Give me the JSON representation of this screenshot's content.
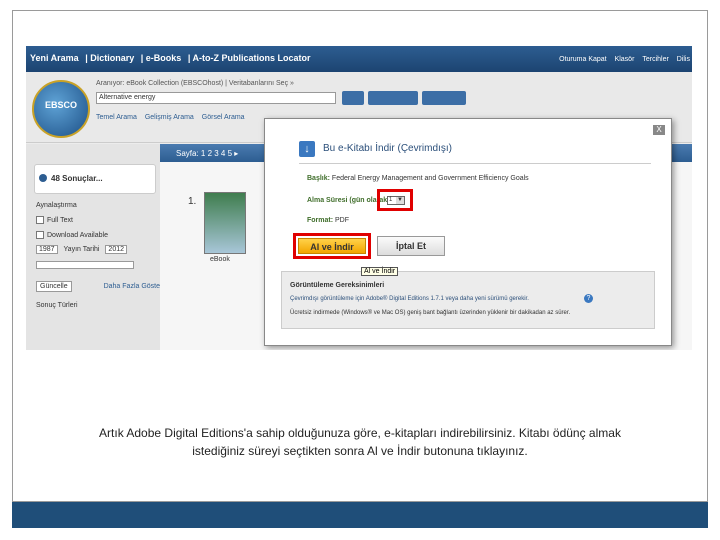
{
  "top_nav": {
    "links": [
      "Yeni Arama",
      "| Dictionary",
      "| e-Books",
      "| A-to-Z Publications Locator"
    ],
    "right": [
      "Oturuma Kapat",
      "Klasör",
      "Tercihler",
      "Dilis"
    ]
  },
  "header": {
    "logo_text": "EBSCO",
    "search_label": "Aranıyor: eBook Collection (EBSCOhost)  |  Veritabanlarını Seç »",
    "search_value": "Alternative energy",
    "search_links": [
      "Temel Arama",
      "Gelişmiş Arama",
      "Görsel Arama"
    ]
  },
  "left_panel": {
    "results_label": "48 Sonuçlar...",
    "refine_label": "Aynalaştırma",
    "filters": [
      "Full Text",
      "Download Available"
    ],
    "year_from": "1987",
    "year_label": "Yayın Tarihi",
    "year_to": "2012",
    "update_button": "Güncelle",
    "more_link": "Daha Fazla Göster »",
    "subject_label": "Sonuç Türleri"
  },
  "pager": {
    "text": "Sayfa: 1 2 3 4 5 ▸"
  },
  "result": {
    "number": "1.",
    "format": "eBook"
  },
  "dialog": {
    "title": "Bu e-Kitabı İndir (Çevrimdışı)",
    "title_label": "Başlık:",
    "title_value": "Federal Energy Management and Government Efficiency Goals",
    "loan_label": "Alma Süresi (gün olarak):",
    "loan_value": "1",
    "format_label": "Format:",
    "format_value": "PDF",
    "get_button": "Al ve İndir",
    "cancel_button": "İptal Et",
    "tooltip": "Al ve İndir",
    "close_label": "X",
    "requirements": {
      "heading": "Görüntüleme Gereksinimleri",
      "line1": "Çevrimdışı görüntüleme için Adobe® Digital Editions 1.7.1 veya daha yeni sürümü gerekir.",
      "line2": "Ücretsiz indirmede (Windows® ve Mac OS) geniş bant bağlantı üzerinden yüklenir bir dakikadan az sürer."
    }
  },
  "caption": {
    "line1": "Artık Adobe Digital Editions'a sahip olduğunuza göre, e-kitapları indirebilirsiniz. Kitabı ödünç almak",
    "line2": "istediğiniz süreyi seçtikten sonra Al ve İndir butonuna tıklayınız."
  },
  "colors": {
    "nav_blue": "#1f4e79",
    "highlight_red": "#e00000",
    "get_button_yellow": "#f2a500"
  }
}
